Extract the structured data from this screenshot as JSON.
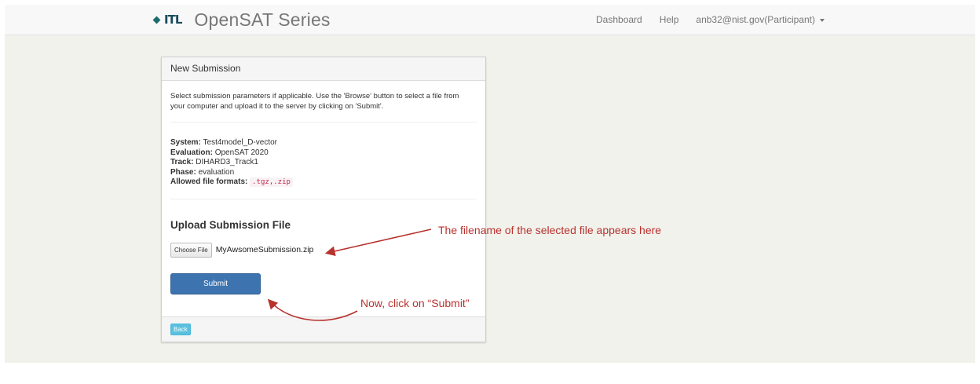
{
  "navbar": {
    "logo_text": "ITL",
    "title": "OpenSAT Series",
    "links": [
      "Dashboard",
      "Help"
    ],
    "user_menu": "anb32@nist.gov(Participant)"
  },
  "panel": {
    "heading": "New Submission",
    "intro": "Select submission parameters if applicable. Use the 'Browse' button to select a file from your computer and upload it to the server by clicking on 'Submit'.",
    "params": {
      "system_label": "System:",
      "system_value": "Test4model_D-vector",
      "evaluation_label": "Evaluation:",
      "evaluation_value": "OpenSAT 2020",
      "track_label": "Track:",
      "track_value": "DIHARD3_Track1",
      "phase_label": "Phase:",
      "phase_value": "evaluation",
      "formats_label": "Allowed file formats:",
      "formats_value": ".tgz,.zip"
    },
    "upload_title": "Upload Submission File",
    "choose_file_label": "Choose File",
    "file_name": "MyAwsomeSubmission.zip",
    "submit_label": "Submit",
    "back_label": "Back"
  },
  "annotations": {
    "filename_note": "The filename of the selected file appears here",
    "submit_note": "Now, click on “Submit”",
    "color": "#b8322e"
  }
}
